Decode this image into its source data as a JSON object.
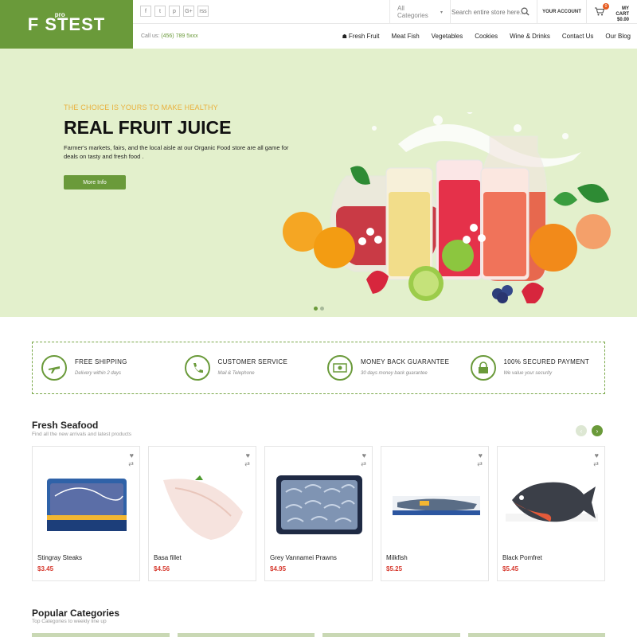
{
  "header": {
    "logo_text": "F STEST",
    "logo_pro": "pro",
    "socials": [
      "f",
      "t",
      "p",
      "G+",
      "rss"
    ],
    "category_select": "All Categories",
    "search_placeholder": "Search entire store here...",
    "account_label": "YOUR ACCOUNT",
    "cart_count": "0",
    "cart_label": "MY CART",
    "cart_total": "$0.00",
    "phone_label": "Call us:",
    "phone_number": "(456) 789 5xxx",
    "nav": [
      "Fresh Fruit",
      "Meat Fish",
      "Vegetables",
      "Cookies",
      "Wine & Drinks",
      "Contact Us",
      "Our Blog"
    ]
  },
  "hero": {
    "tagline": "THE CHOICE IS YOURS TO MAKE HEALTHY",
    "title": "REAL FRUIT JUICE",
    "description": "Farmer's markets, fairs, and the local aisle at our Organic Food store are all game for deals on tasty and fresh food .",
    "button": "More Info",
    "slides": 2,
    "active_slide": 1
  },
  "features": [
    {
      "title": "FREE SHIPPING",
      "subtitle": "Delivery within 2 days",
      "icon": "plane-icon"
    },
    {
      "title": "CUSTOMER SERVICE",
      "subtitle": "Mail & Telephone",
      "icon": "phone-icon"
    },
    {
      "title": "MONEY BACK GUARANTEE",
      "subtitle": "30 days money back guarantee",
      "icon": "money-icon"
    },
    {
      "title": "100% SECURED PAYMENT",
      "subtitle": "We value your security",
      "icon": "lock-icon"
    }
  ],
  "seafood": {
    "title": "Fresh Seafood",
    "subtitle": "Find all the new arrivals and latest products",
    "products": [
      {
        "name": "Stingray Steaks",
        "price": "$3.45"
      },
      {
        "name": "Basa fillet",
        "price": "$4.56"
      },
      {
        "name": "Grey Vannamei Prawns",
        "price": "$4.95"
      },
      {
        "name": "Milkfish",
        "price": "$5.25"
      },
      {
        "name": "Black Pomfret",
        "price": "$5.45"
      }
    ]
  },
  "popular": {
    "title": "Popular Categories",
    "subtitle": "Top Categories to weekly line up"
  },
  "colors": {
    "accent": "#6a9a3a",
    "price": "#d63a2f",
    "hero_bg": "#e3f0cc"
  }
}
